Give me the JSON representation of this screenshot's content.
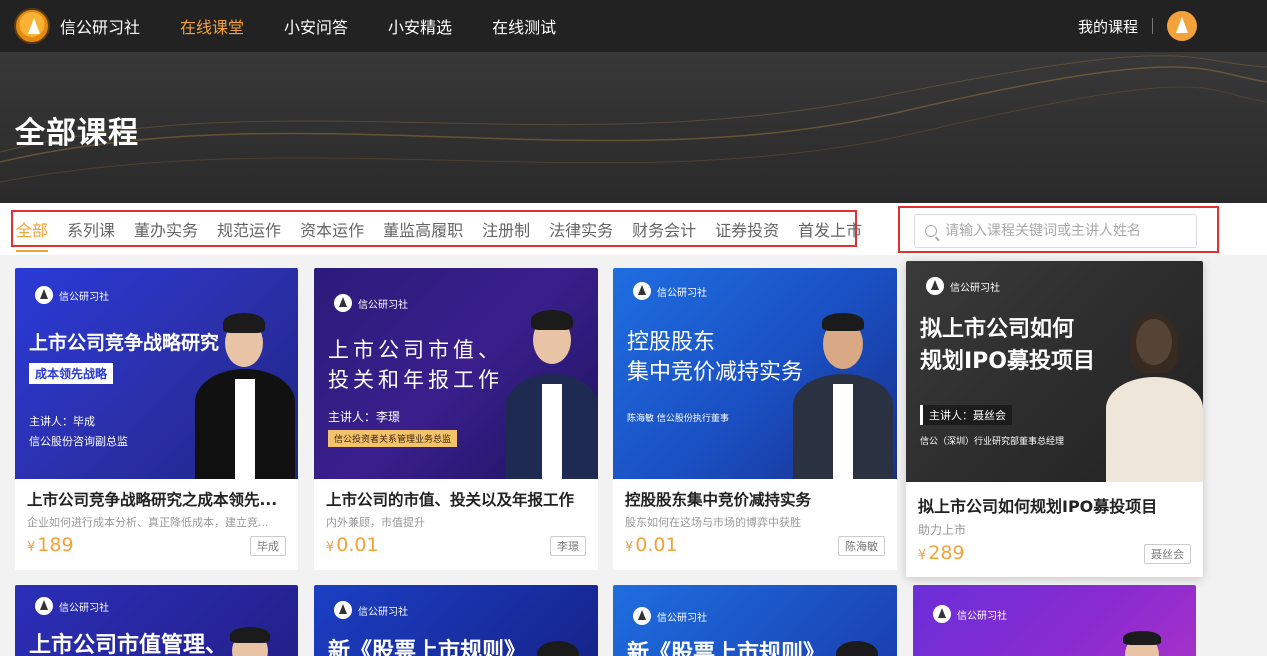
{
  "nav": {
    "brand": "信公研习社",
    "items": [
      "在线课堂",
      "小安问答",
      "小安精选",
      "在线测试"
    ],
    "active_index": 0,
    "my_courses": "我的课程",
    "logo_icon": "brand-logo-icon",
    "avatar_icon": "user-avatar-icon"
  },
  "hero": {
    "title": "全部课程"
  },
  "filters": {
    "categories": [
      "全部",
      "系列课",
      "董办实务",
      "规范运作",
      "资本运作",
      "董监高履职",
      "注册制",
      "法律实务",
      "财务会计",
      "证券投资",
      "首发上市"
    ],
    "active_index": 0,
    "search_placeholder": "请输入课程关键词或主讲人姓名"
  },
  "colors": {
    "accent": "#f0a33a",
    "highlight_box": "#e03030",
    "nav_bg": "#222222"
  },
  "courses": [
    {
      "thumb": {
        "brand": "信公研习社",
        "title": "上市公司竞争战略研究",
        "tag": "成本领先战略",
        "lines": [
          "主讲人：毕成",
          "信公股份咨询副总监"
        ]
      },
      "title": "上市公司竞争战略研究之成本领先...",
      "subtitle": "企业如何进行成本分析、真正降低成本，建立竞...",
      "currency": "¥",
      "price": "189",
      "lecturer": "毕成"
    },
    {
      "thumb": {
        "brand": "信公研习社",
        "title_lines": [
          "上市公司市值、",
          "投关和年报工作"
        ],
        "lines": [
          "主讲人：李璟"
        ],
        "tag": "信公投资者关系管理业务总监"
      },
      "title": "上市公司的市值、投关以及年报工作",
      "subtitle": "内外兼顾，市值提升",
      "currency": "¥",
      "price": "0.01",
      "lecturer": "李璟"
    },
    {
      "thumb": {
        "brand": "信公研习社",
        "title_lines": [
          "控股股东",
          "集中竞价减持实务"
        ],
        "lines": [
          "陈海敏 信公股份执行董事"
        ]
      },
      "title": "控股股东集中竞价减持实务",
      "subtitle": "股东如何在这场与市场的博弈中获胜",
      "currency": "¥",
      "price": "0.01",
      "lecturer": "陈海敏"
    },
    {
      "thumb": {
        "brand": "信公研习社",
        "title_lines": [
          "拟上市公司如何",
          "规划IPO募投项目"
        ],
        "tag": "主讲人：聂丝会",
        "lines": [
          "信公（深圳）行业研究部董事总经理"
        ]
      },
      "title": "拟上市公司如何规划IPO募投项目",
      "subtitle": "助力上市",
      "currency": "¥",
      "price": "289",
      "lecturer": "聂丝会"
    }
  ],
  "courses_row2": [
    {
      "brand": "信公研习社",
      "title": "上市公司市值管理、"
    },
    {
      "brand": "信公研习社",
      "title": "新《股票上市规则》"
    },
    {
      "brand": "信公研习社",
      "title": "新《股票上市规则》"
    },
    {
      "brand": "信公研习社",
      "title": ""
    }
  ]
}
